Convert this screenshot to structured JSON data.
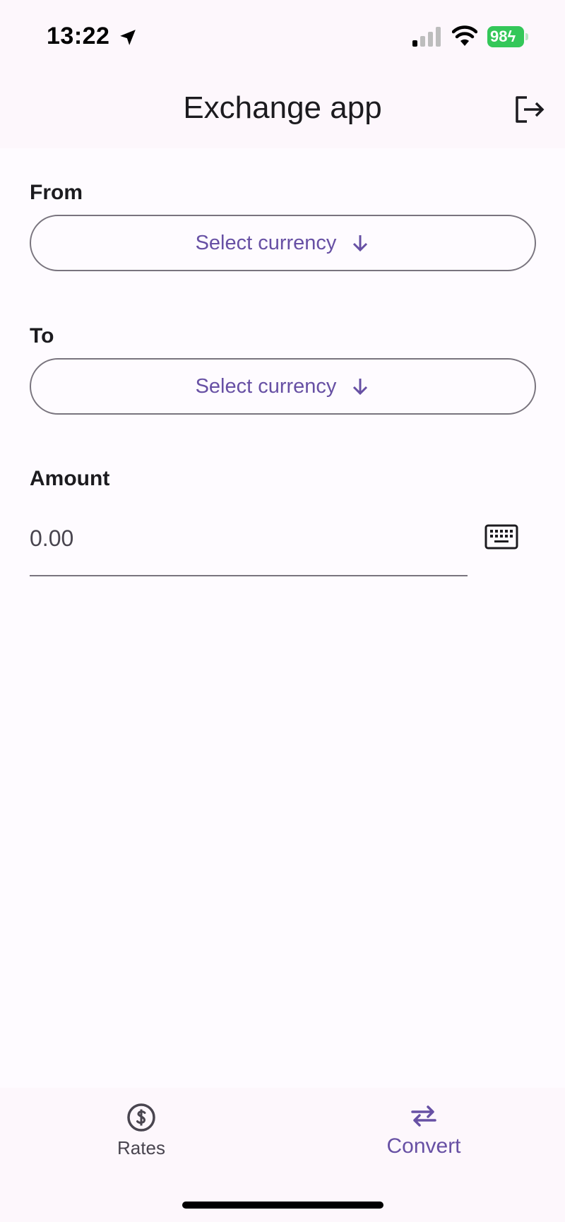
{
  "status_bar": {
    "time": "13:22",
    "battery": "98"
  },
  "app_bar": {
    "title": "Exchange app",
    "logout_icon": "logout-icon"
  },
  "form": {
    "from": {
      "label": "From",
      "button_label": "Select currency",
      "icon": "arrow-down-icon"
    },
    "to": {
      "label": "To",
      "button_label": "Select currency",
      "icon": "arrow-down-icon"
    },
    "amount": {
      "label": "Amount",
      "placeholder": "0.00",
      "value": "",
      "icon": "keyboard-icon"
    }
  },
  "bottom_nav": {
    "items": [
      {
        "label": "Rates",
        "icon": "dollar-circle-icon",
        "active": false
      },
      {
        "label": "Convert",
        "icon": "swap-arrows-icon",
        "active": true
      }
    ]
  },
  "colors": {
    "accent": "#6750a4",
    "surface": "#fdf7fc",
    "background": "#fefbff",
    "outline": "#79747e",
    "battery": "#34c759"
  }
}
